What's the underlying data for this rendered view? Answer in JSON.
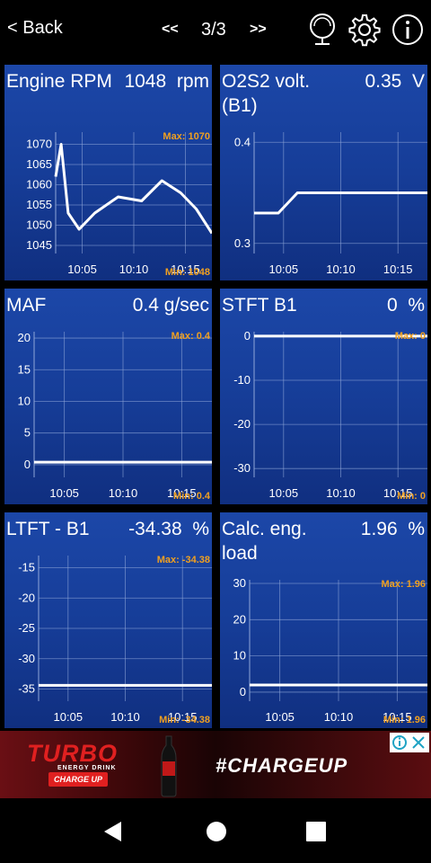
{
  "header": {
    "back_label": "< Back",
    "prev_label": "<<",
    "page_indicator": "3/3",
    "next_label": ">>",
    "icons": [
      "gauge-icon",
      "gear-icon",
      "info-icon"
    ]
  },
  "colors": {
    "panel": "#163d98",
    "max_min_label": "#f0a020",
    "line": "#ffffff"
  },
  "panels": [
    {
      "title": "Engine RPM",
      "value": "1048",
      "unit": "rpm",
      "max_label": "Max: 1070",
      "min_label": "Min: 1048",
      "chart_data": {
        "type": "line",
        "xticks": [
          "10:05",
          "10:10",
          "10:15"
        ],
        "yticks": [
          "1070",
          "1065",
          "1060",
          "1055",
          "1050",
          "1045"
        ],
        "ylim": [
          1043,
          1073
        ],
        "x": [
          0,
          3.5,
          8,
          15,
          25,
          40,
          55,
          68,
          80,
          90,
          100
        ],
        "y": [
          1062,
          1070,
          1053,
          1049,
          1053,
          1057,
          1056,
          1061,
          1058,
          1054,
          1048
        ]
      }
    },
    {
      "title": "O2S2 volt. (B1)",
      "value": "0.35",
      "unit": "V",
      "max_label": "",
      "min_label": "",
      "chart_data": {
        "type": "line",
        "xticks": [
          "10:05",
          "10:10",
          "10:15"
        ],
        "yticks": [
          "0.4",
          "0.3"
        ],
        "ylim": [
          0.29,
          0.41
        ],
        "x": [
          0,
          14,
          25,
          100
        ],
        "y": [
          0.33,
          0.33,
          0.35,
          0.35
        ]
      }
    },
    {
      "title": "MAF",
      "value": "0.4",
      "unit": "g/sec",
      "max_label": "Max: 0.4",
      "min_label": "Min: 0.4",
      "chart_data": {
        "type": "line",
        "xticks": [
          "10:05",
          "10:10",
          "10:15"
        ],
        "yticks": [
          "20",
          "15",
          "10",
          "5",
          "0"
        ],
        "ylim": [
          -2,
          21
        ],
        "x": [
          0,
          100
        ],
        "y": [
          0.4,
          0.4
        ]
      }
    },
    {
      "title": "STFT B1",
      "value": "0",
      "unit": "%",
      "max_label": "Max: 0",
      "min_label": "Min: 0",
      "chart_data": {
        "type": "line",
        "xticks": [
          "10:05",
          "10:10",
          "10:15"
        ],
        "yticks": [
          "0",
          "-10",
          "-20",
          "-30"
        ],
        "ylim": [
          -32,
          1
        ],
        "x": [
          0,
          100
        ],
        "y": [
          0,
          0
        ]
      }
    },
    {
      "title": "LTFT - B1",
      "value": "-34.38",
      "unit": "%",
      "max_label": "Max: -34.38",
      "min_label": "Min: -34.38",
      "chart_data": {
        "type": "line",
        "xticks": [
          "10:05",
          "10:10",
          "10:15"
        ],
        "yticks": [
          "-15",
          "-20",
          "-25",
          "-30",
          "-35"
        ],
        "ylim": [
          -37,
          -13
        ],
        "x": [
          0,
          100
        ],
        "y": [
          -34.38,
          -34.38
        ]
      }
    },
    {
      "title": "Calc. eng. load",
      "value": "1.96",
      "unit": "%",
      "max_label": "Max: 1.96",
      "min_label": "Min: 1.96",
      "chart_data": {
        "type": "line",
        "xticks": [
          "10:05",
          "10:10",
          "10:15"
        ],
        "yticks": [
          "30",
          "20",
          "10",
          "0"
        ],
        "ylim": [
          -2.5,
          31
        ],
        "x": [
          0,
          100
        ],
        "y": [
          1.96,
          1.96
        ]
      }
    }
  ],
  "ad": {
    "brand": "TURBO",
    "brand_sub": "ENERGY DRINK",
    "cta": "CHARGE UP",
    "hashtag": "#CHARGEUP"
  },
  "system_nav": [
    "back-icon",
    "home-icon",
    "recents-icon"
  ]
}
